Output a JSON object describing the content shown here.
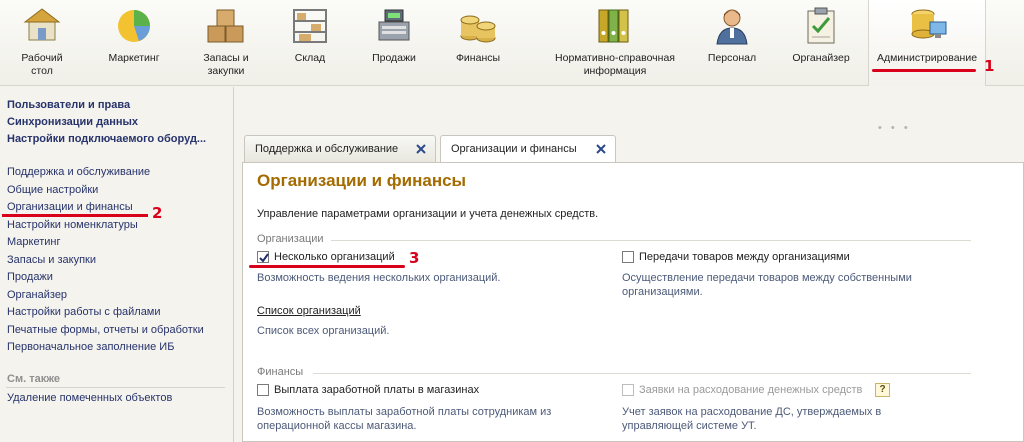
{
  "toolbar": {
    "items": [
      {
        "label": "Рабочий\nстол",
        "icon": "desktop-home-icon"
      },
      {
        "label": "Маркетинг",
        "icon": "pie-chart-icon"
      },
      {
        "label": "Запасы и\nзакупки",
        "icon": "boxes-icon"
      },
      {
        "label": "Склад",
        "icon": "warehouse-shelves-icon"
      },
      {
        "label": "Продажи",
        "icon": "cash-register-icon"
      },
      {
        "label": "Финансы",
        "icon": "coin-stacks-icon"
      },
      {
        "label": "Нормативно-справочная\nинформация",
        "icon": "binders-icon"
      },
      {
        "label": "Персонал",
        "icon": "person-icon"
      },
      {
        "label": "Органайзер",
        "icon": "clipboard-check-icon"
      },
      {
        "label": "Администрирование",
        "icon": "database-computer-icon"
      }
    ],
    "active_index": 9
  },
  "sidebar": {
    "bold_links": [
      "Пользователи и права",
      "Синхронизации данных",
      "Настройки подключаемого оборуд..."
    ],
    "links": [
      "Поддержка и обслуживание",
      "Общие настройки",
      "Организации и финансы",
      "Настройки номенклатуры",
      "Маркетинг",
      "Запасы и закупки",
      "Продажи",
      "Органайзер",
      "Настройки работы с файлами",
      "Печатные формы, отчеты и обработки",
      "Первоначальное заполнение ИБ"
    ],
    "see_also_label": "См. также",
    "see_also_links": [
      "Удаление помеченных объектов"
    ]
  },
  "tabs": [
    {
      "label": "Поддержка и обслуживание",
      "active": false
    },
    {
      "label": "Организации и финансы",
      "active": true
    }
  ],
  "main": {
    "title": "Организации и финансы",
    "description": "Управление параметрами организации и учета денежных средств.",
    "organizations": {
      "header": "Организации",
      "multiple_orgs_label": "Несколько организаций",
      "multiple_orgs_checked": true,
      "multiple_orgs_desc": "Возможность ведения нескольких организаций.",
      "transfer_label": "Передачи товаров между организациями",
      "transfer_checked": false,
      "transfer_desc": "Осуществление передачи товаров между собственными организациями.",
      "org_list_link": "Список организаций",
      "org_list_desc": "Список всех организаций."
    },
    "finances": {
      "header": "Финансы",
      "salary_label": "Выплата заработной платы в магазинах",
      "salary_checked": false,
      "salary_desc": "Возможность выплаты заработной платы сотрудникам из операционной кассы магазина.",
      "requests_label": "Заявки на расходование денежных средств",
      "requests_checked": false,
      "requests_desc": "Учет заявок на расходование ДС, утверждаемых в управляющей системе УТ.",
      "help_label": "?"
    }
  },
  "annotations": {
    "one": "1",
    "two": "2",
    "three": "3"
  },
  "colors": {
    "accent_title": "#a36b00",
    "link": "#27336b",
    "annotation": "#d9001b"
  }
}
